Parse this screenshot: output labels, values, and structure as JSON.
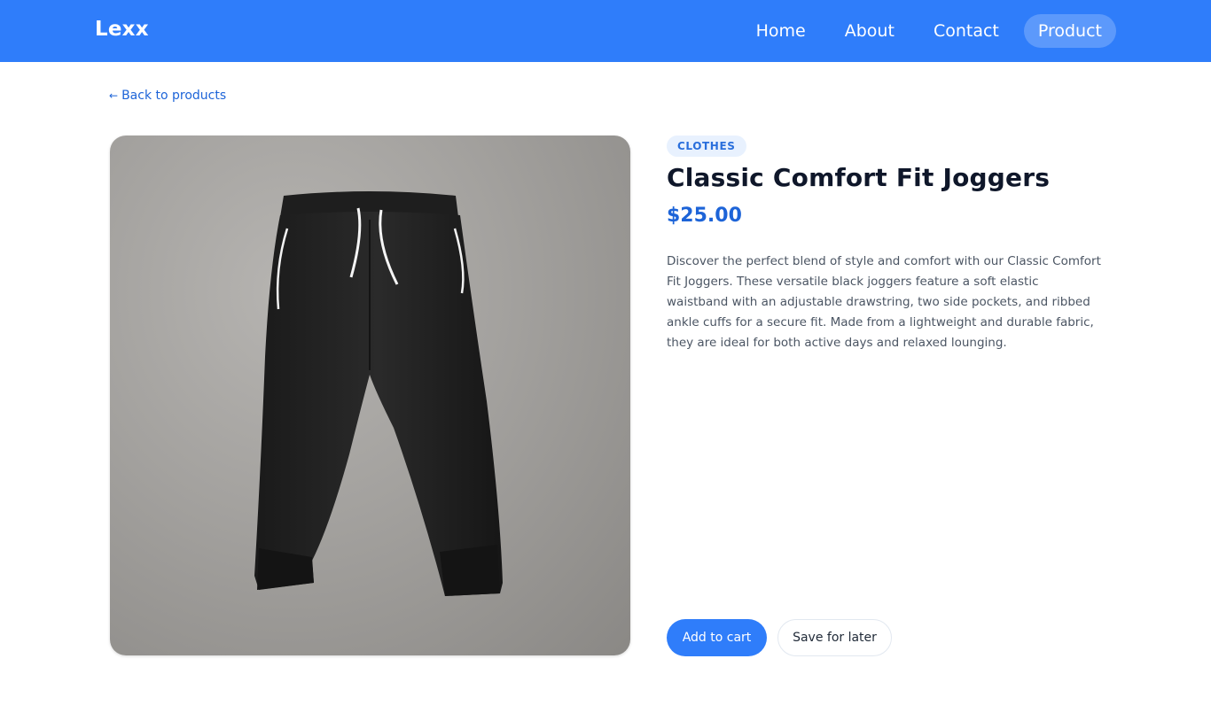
{
  "nav": {
    "brand": "Lexx",
    "links": [
      {
        "label": "Home"
      },
      {
        "label": "About"
      },
      {
        "label": "Contact"
      },
      {
        "label": "Product"
      }
    ],
    "active": "Product"
  },
  "back_link": {
    "icon": "arrow-left-icon",
    "arrow": "←",
    "label": "Back to products"
  },
  "product": {
    "image_icon": "product-image-joggers",
    "category": "CLOTHES",
    "title": "Classic Comfort Fit Joggers",
    "price": "$25.00",
    "description": "Discover the perfect blend of style and comfort with our Classic Comfort Fit Joggers. These versatile black joggers feature a soft elastic waistband with an adjustable drawstring, two side pockets, and ribbed ankle cuffs for a secure fit. Made from a lightweight and durable fabric, they are ideal for both active days and relaxed lounging."
  },
  "actions": {
    "add_to_cart": "Add to cart",
    "save_for_later": "Save for later"
  },
  "colors": {
    "accent": "#2f7dfa",
    "link": "#1d64d8",
    "badge_bg": "#e8f1fe"
  }
}
